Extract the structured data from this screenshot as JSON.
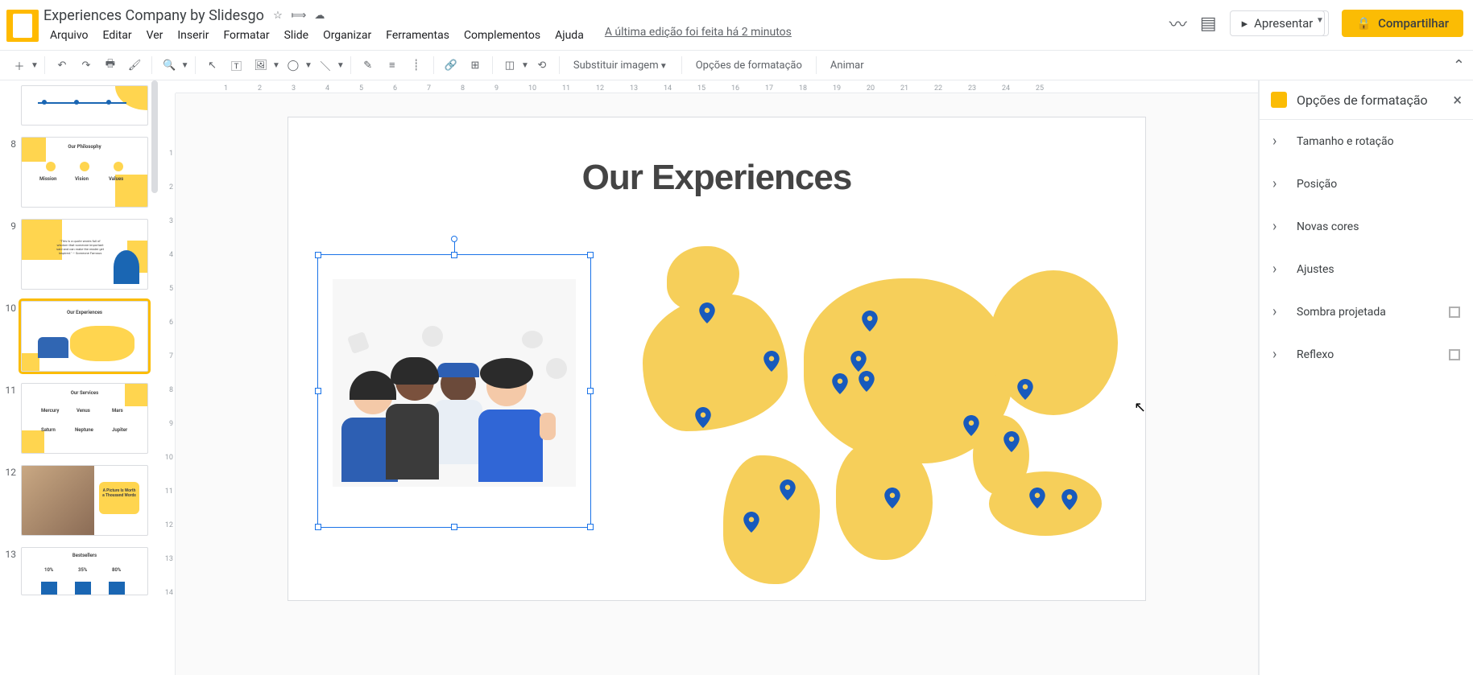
{
  "doc": {
    "title": "Experiences Company by Slidesgo"
  },
  "menus": {
    "file": "Arquivo",
    "edit": "Editar",
    "view": "Ver",
    "insert": "Inserir",
    "format": "Formatar",
    "slide": "Slide",
    "arrange": "Organizar",
    "tools": "Ferramentas",
    "addons": "Complementos",
    "help": "Ajuda"
  },
  "edit_status": "A última edição foi feita há 2 minutos",
  "header_right": {
    "present": "Apresentar",
    "share": "Compartilhar"
  },
  "toolbar": {
    "replace_image": "Substituir imagem",
    "format_options": "Opções de formatação",
    "animate": "Animar"
  },
  "thumbs": {
    "n8": "8",
    "t8": "Our Philosophy",
    "c8a": "Mission",
    "c8b": "Vision",
    "c8c": "Values",
    "n9": "9",
    "t9": "\"This is a quote words full of wisdom that someone important said and can make the reader get inspired.\" — Someone Famous",
    "n10": "10",
    "t10": "Our Experiences",
    "n11": "11",
    "t11": "Our Services",
    "c11a": "Mercury",
    "c11b": "Venus",
    "c11c": "Mars",
    "c11d": "Saturn",
    "c11e": "Neptune",
    "c11f": "Jupiter",
    "n12": "12",
    "t12": "A Picture Is Worth a Thousand Words",
    "n13": "13",
    "t13": "Bestsellers",
    "c13a": "10%",
    "c13b": "35%",
    "c13c": "80%"
  },
  "slide": {
    "title": "Our Experiences"
  },
  "ruler_h": [
    "",
    "1",
    "2",
    "3",
    "4",
    "5",
    "6",
    "7",
    "8",
    "9",
    "10",
    "11",
    "12",
    "13",
    "14",
    "15",
    "16",
    "17",
    "18",
    "19",
    "20",
    "21",
    "22",
    "23",
    "24",
    "25"
  ],
  "ruler_v": [
    "",
    "1",
    "2",
    "3",
    "4",
    "5",
    "6",
    "7",
    "8",
    "9",
    "10",
    "11",
    "12",
    "13",
    "14"
  ],
  "sidebar": {
    "title": "Opções de formatação",
    "items": {
      "size": "Tamanho e rotação",
      "position": "Posição",
      "recolor": "Novas cores",
      "adjust": "Ajustes",
      "shadow": "Sombra projetada",
      "reflection": "Reflexo"
    }
  }
}
